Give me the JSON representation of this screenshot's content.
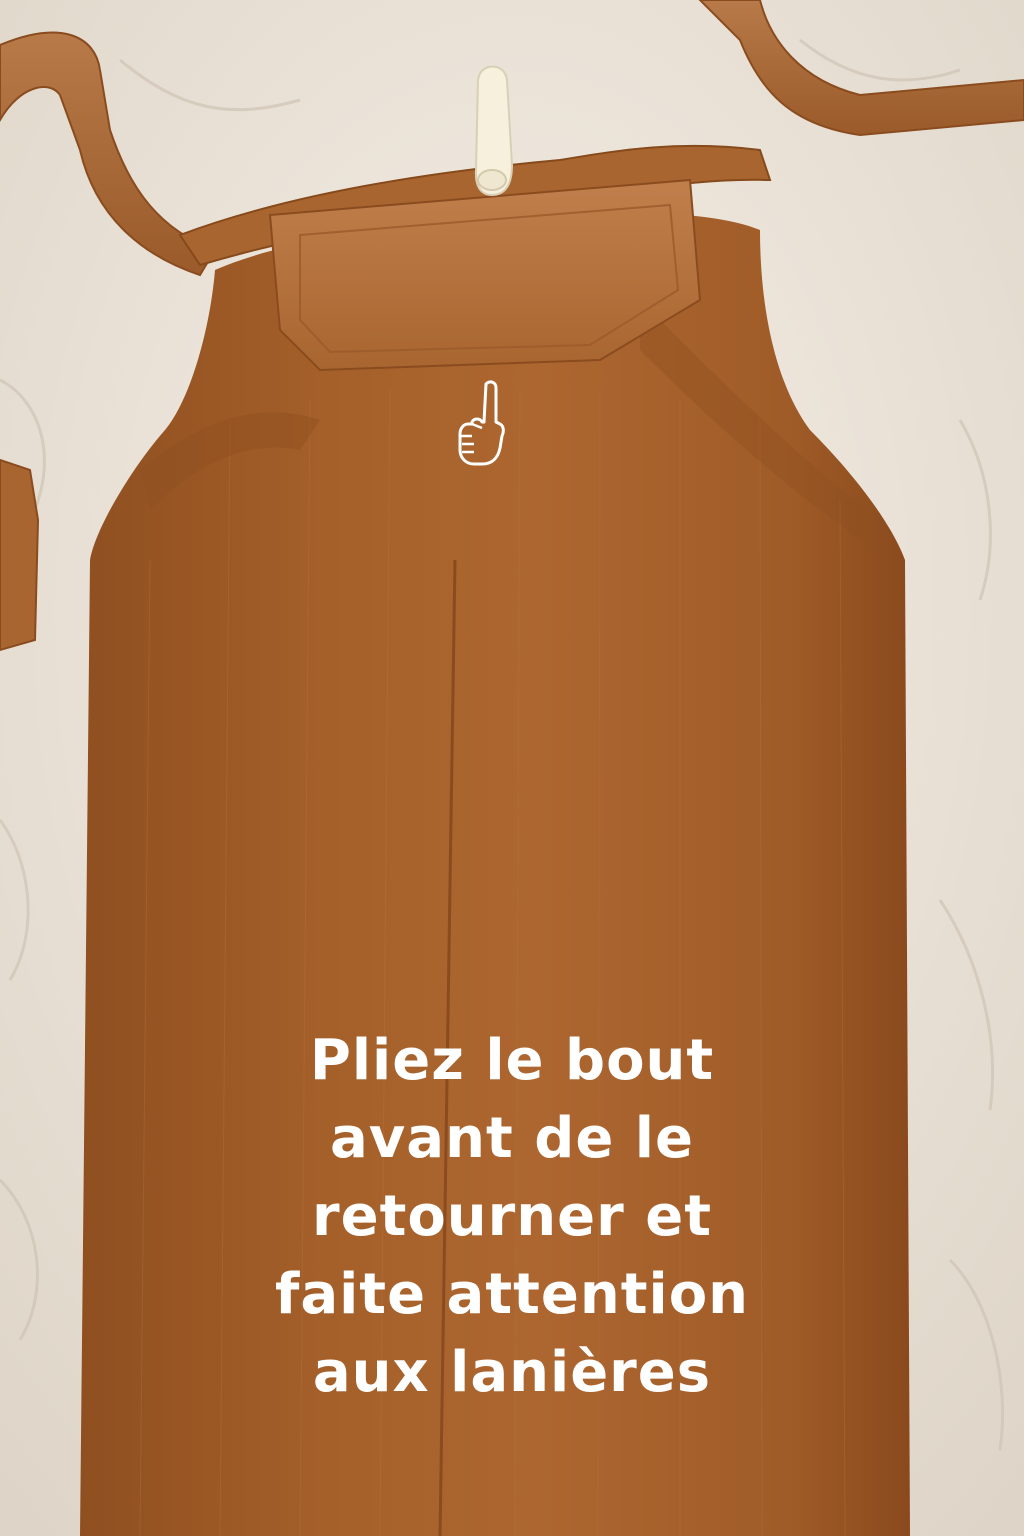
{
  "scene": {
    "background_color": "#ece4da",
    "sheet_color": "#f3ece3",
    "fabric_color": "#a8612b",
    "fabric_dark": "#8a4c1f",
    "strap_color": "#b0703f",
    "hanger_color": "#f6f0dd"
  },
  "pointer": {
    "icon": "pointing-finger-up-icon",
    "color": "#ffffff"
  },
  "caption": {
    "lines": [
      "Pliez le bout",
      "avant de le",
      "retourner et",
      "faite attention",
      "aux lanières"
    ]
  }
}
